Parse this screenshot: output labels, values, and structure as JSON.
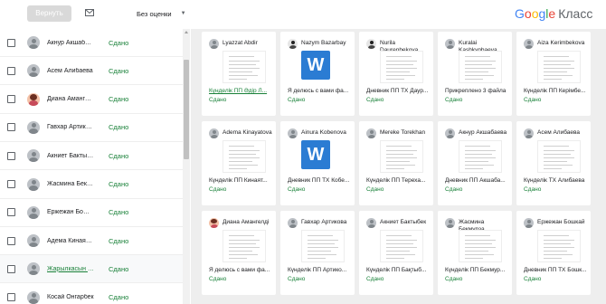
{
  "toolbar": {
    "return_label": "Вернуть",
    "grade_filter": "Без оценки",
    "brand_google": [
      "G",
      "o",
      "o",
      "g",
      "l",
      "e"
    ],
    "brand_product": "Класс"
  },
  "students": [
    {
      "name": "Акнур Акшабаева",
      "status": "Сдано",
      "avatar": "default"
    },
    {
      "name": "Асем Алибаева",
      "status": "Сдано",
      "avatar": "default"
    },
    {
      "name": "Диана Амангелді",
      "status": "Сдано",
      "avatar": "photo"
    },
    {
      "name": "Гавхар Артикова",
      "status": "Сдано",
      "avatar": "default"
    },
    {
      "name": "Акниет Бактыбек",
      "status": "Сдано",
      "avatar": "default"
    },
    {
      "name": "Жасмина Бекмурзаева",
      "status": "Сдано",
      "avatar": "default"
    },
    {
      "name": "Ержежан Бошкай",
      "status": "Сдано",
      "avatar": "default"
    },
    {
      "name": "Адема Кинаятова",
      "status": "Сдано",
      "avatar": "default"
    },
    {
      "name": "Жарылкасын М...",
      "status": "Сдано",
      "avatar": "default"
    },
    {
      "name": "Косай Онгарбек",
      "status": "Сдано",
      "avatar": "default"
    }
  ],
  "cards": [
    {
      "name": "Lyazzat Abdir",
      "title": "Күнделік ПП Әдір Л...",
      "status": "Сдано",
      "thumb": "doc",
      "avatar": "default",
      "title_link": true
    },
    {
      "name": "Nazym Bazarbay",
      "title": "Я делюсь с вами фа...",
      "status": "Сдано",
      "thumb": "word",
      "avatar": "dark",
      "title_link": false
    },
    {
      "name": "Nurila Daurenbekova",
      "title": "Дневник ПП ТХ Даур...",
      "status": "Сдано",
      "thumb": "doc",
      "avatar": "dark",
      "title_link": false
    },
    {
      "name": "Kuralai Kashkynbaeva",
      "title": "Прикреплено 3 файла",
      "status": "Сдано",
      "thumb": "doc",
      "avatar": "default",
      "title_link": false
    },
    {
      "name": "Aiza Kerimbekova",
      "title": "Күнделік ПП Керімбе...",
      "status": "Сдано",
      "thumb": "doc",
      "avatar": "default",
      "title_link": false
    },
    {
      "name": "Adema Kinayatova",
      "title": "Күнделік ПП Кинаят...",
      "status": "Сдано",
      "thumb": "doc",
      "avatar": "default",
      "title_link": false
    },
    {
      "name": "Ainura Kobenova",
      "title": "Дневник ПП ТХ Кобе...",
      "status": "Сдано",
      "thumb": "word",
      "avatar": "default",
      "title_link": false
    },
    {
      "name": "Mereke Torekhan",
      "title": "Күнделік ПП Тереха...",
      "status": "Сдано",
      "thumb": "doc",
      "avatar": "default",
      "title_link": false
    },
    {
      "name": "Акнур Акшабаева",
      "title": "Дневник ПП Акшаба...",
      "status": "Сдано",
      "thumb": "doc",
      "avatar": "default",
      "title_link": false
    },
    {
      "name": "Асем Алибаева",
      "title": "Күнделік ТХ Алибаева",
      "status": "Сдано",
      "thumb": "doc",
      "avatar": "default",
      "title_link": false
    },
    {
      "name": "Диана Амангелді",
      "title": "Я делюсь с вами фа...",
      "status": "Сдано",
      "thumb": "doc",
      "avatar": "photo",
      "title_link": false
    },
    {
      "name": "Гавхар Артикова",
      "title": "Күнделік ПП Артико...",
      "status": "Сдано",
      "thumb": "doc",
      "avatar": "default",
      "title_link": false
    },
    {
      "name": "Акниет Бактыбек",
      "title": "Күнделік ПП Бақтыб...",
      "status": "Сдано",
      "thumb": "doc",
      "avatar": "default",
      "title_link": false
    },
    {
      "name": "Жасмина Бекмурза",
      "title": "Күнделік ПП Бекмур...",
      "status": "Сдано",
      "thumb": "doc",
      "avatar": "default",
      "title_link": false
    },
    {
      "name": "Ержежан Бошкай",
      "title": "Дневник ПП ТХ Бошк...",
      "status": "Сдано",
      "thumb": "doc",
      "avatar": "default",
      "title_link": false
    }
  ],
  "colors": {
    "status_green": "#188038",
    "word_blue": "#2b7cd3",
    "grid_bg": "#eeeeee"
  }
}
